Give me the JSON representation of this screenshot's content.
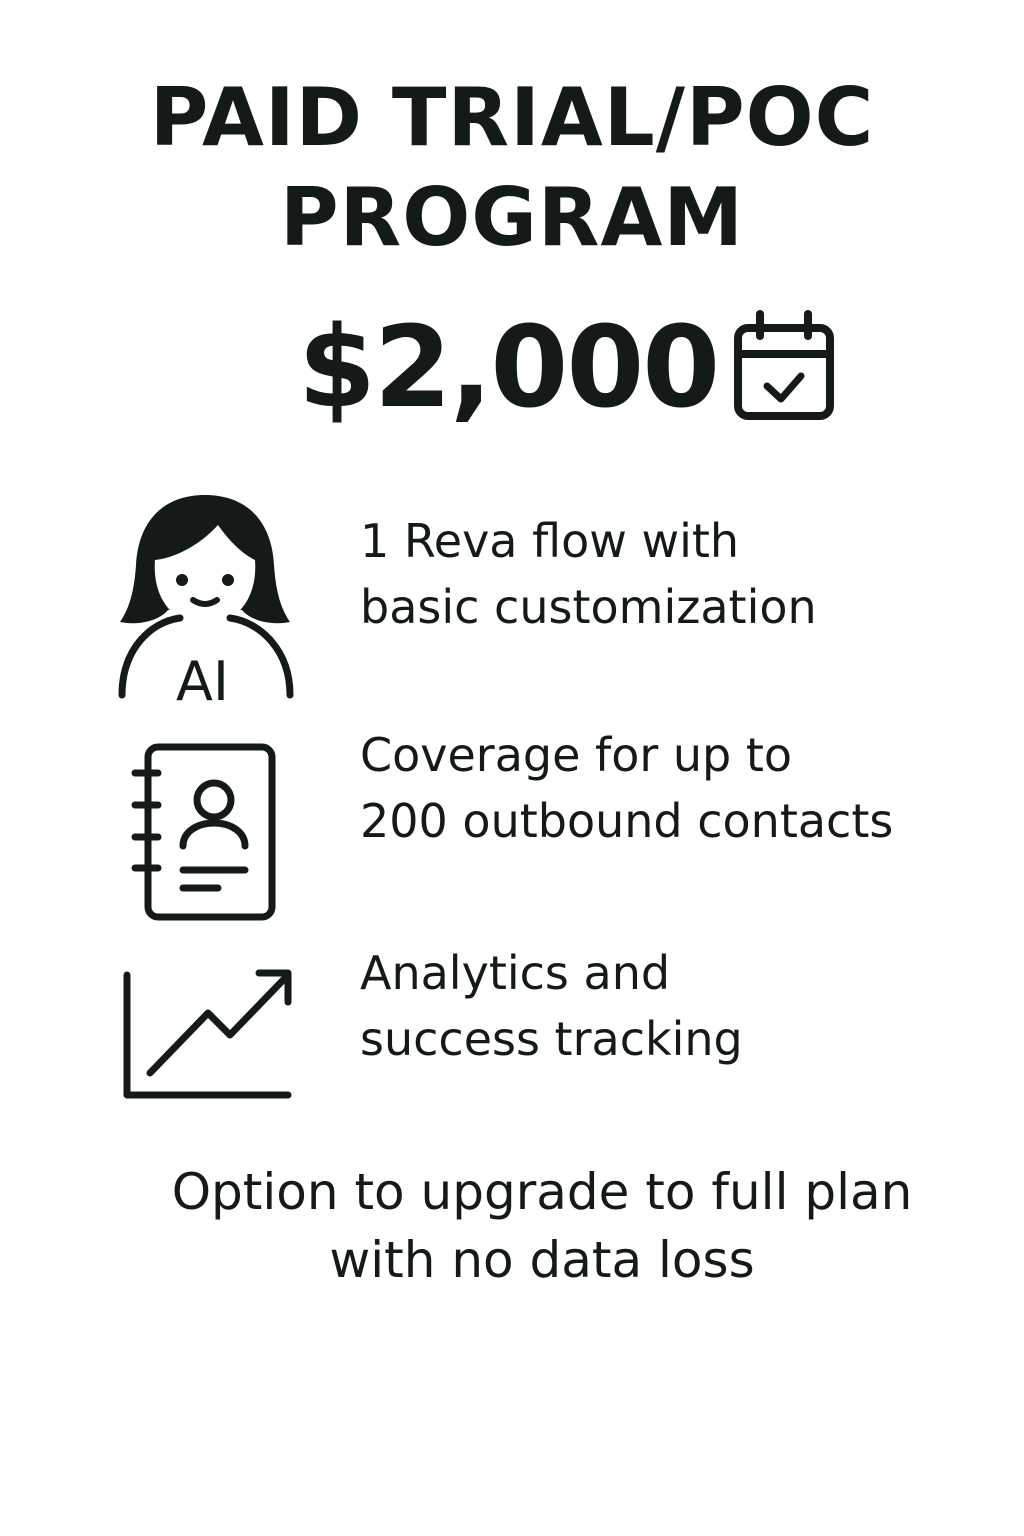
{
  "title": {
    "line1": "PAID TRIAL/POC",
    "line2": "PROGRAM"
  },
  "price": "$2,000",
  "price_icon": "calendar-check-icon",
  "features": [
    {
      "icon": "ai-assistant-icon",
      "icon_label": "AI",
      "line1": "1 Reva flow with",
      "line2": "basic customization"
    },
    {
      "icon": "contact-book-icon",
      "line1": "Coverage for up to",
      "line2": "200 outbound contacts"
    },
    {
      "icon": "trend-chart-icon",
      "line1": "Analytics and",
      "line2": "success tracking"
    }
  ],
  "footer": {
    "line1": "Option to upgrade to full plan",
    "line2": "with no data loss"
  },
  "colors": {
    "text": "#141a1a",
    "background": "#ffffff"
  }
}
